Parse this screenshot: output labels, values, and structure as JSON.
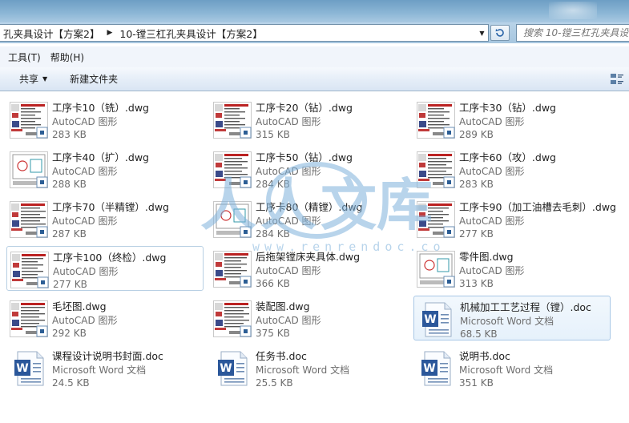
{
  "address": {
    "crumbs": [
      "孔夹具设计【方案2】",
      "10-镗三杠孔夹具设计【方案2】"
    ],
    "search_placeholder": "搜索 10-镗三杠孔夹具设"
  },
  "menu": {
    "tools": "工具(T)",
    "help": "帮助(H)"
  },
  "commands": {
    "share": "共享",
    "new_folder": "新建文件夹"
  },
  "colors": {
    "accent": "#4a8fd1",
    "selection": "#b7cfe3",
    "word_blue": "#2b579a"
  },
  "files": [
    {
      "name": "工序卡10（铣）.dwg",
      "type": "AutoCAD 图形",
      "size": "283 KB",
      "icon": "dwg-thumb"
    },
    {
      "name": "工序卡20（钻）.dwg",
      "type": "AutoCAD 图形",
      "size": "315 KB",
      "icon": "dwg-thumb"
    },
    {
      "name": "工序卡30（钻）.dwg",
      "type": "AutoCAD 图形",
      "size": "289 KB",
      "icon": "dwg-thumb"
    },
    {
      "name": "工序卡40（扩）.dwg",
      "type": "AutoCAD 图形",
      "size": "288 KB",
      "icon": "dwg-thumb"
    },
    {
      "name": "工序卡50（钻）.dwg",
      "type": "AutoCAD 图形",
      "size": "284 KB",
      "icon": "dwg-thumb"
    },
    {
      "name": "工序卡60（攻）.dwg",
      "type": "AutoCAD 图形",
      "size": "283 KB",
      "icon": "dwg-thumb"
    },
    {
      "name": "工序卡70（半精镗）.dwg",
      "type": "AutoCAD 图形",
      "size": "287 KB",
      "icon": "dwg-thumb"
    },
    {
      "name": "工序卡80（精镗）.dwg",
      "type": "AutoCAD 图形",
      "size": "284 KB",
      "icon": "dwg-thumb"
    },
    {
      "name": "工序卡90（加工油槽去毛刺）.dwg",
      "type": "AutoCAD 图形",
      "size": "277 KB",
      "icon": "dwg-thumb"
    },
    {
      "name": "工序卡100（终检）.dwg",
      "type": "AutoCAD 图形",
      "size": "277 KB",
      "icon": "dwg-thumb"
    },
    {
      "name": "后拖架镗床夹具体.dwg",
      "type": "AutoCAD 图形",
      "size": "366 KB",
      "icon": "dwg-thumb"
    },
    {
      "name": "零件图.dwg",
      "type": "AutoCAD 图形",
      "size": "313 KB",
      "icon": "dwg-thumb"
    },
    {
      "name": "毛坯图.dwg",
      "type": "AutoCAD 图形",
      "size": "292 KB",
      "icon": "dwg-thumb"
    },
    {
      "name": "装配图.dwg",
      "type": "AutoCAD 图形",
      "size": "375 KB",
      "icon": "dwg-thumb"
    },
    {
      "name": "机械加工工艺过程（镗）.doc",
      "type": "Microsoft Word 文档",
      "size": "68.5 KB",
      "icon": "word-doc-icon"
    },
    {
      "name": "课程设计说明书封面.doc",
      "type": "Microsoft Word 文档",
      "size": "24.5 KB",
      "icon": "word-doc-icon"
    },
    {
      "name": "任务书.doc",
      "type": "Microsoft Word 文档",
      "size": "25.5 KB",
      "icon": "word-doc-icon"
    },
    {
      "name": "说明书.doc",
      "type": "Microsoft Word 文档",
      "size": "351 KB",
      "icon": "word-doc-icon"
    }
  ]
}
